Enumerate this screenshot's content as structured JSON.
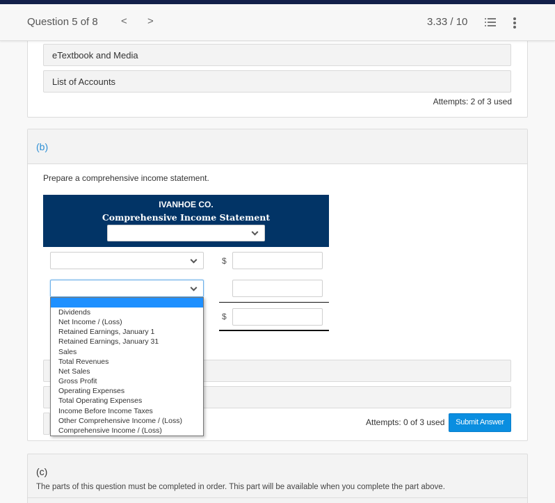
{
  "header": {
    "question_label": "Question 5 of 8",
    "prev_icon": "chevron-left-icon",
    "next_icon": "chevron-right-icon",
    "prev_glyph": "<",
    "next_glyph": ">",
    "score": "3.33 / 10",
    "list_icon": "numbered-list-icon",
    "more_icon": "more-vertical-icon"
  },
  "part_a": {
    "resources": [
      {
        "label": "eTextbook and Media"
      },
      {
        "label": "List of Accounts"
      }
    ],
    "attempts": "Attempts: 2 of 3 used"
  },
  "part_b": {
    "label": "(b)",
    "instruction": "Prepare a comprehensive income statement.",
    "statement": {
      "company": "IVANHOE CO.",
      "title": "Comprehensive Income Statement",
      "date_select_value": "",
      "rows": [
        {
          "account_value": "",
          "dollar": "$",
          "amount": ""
        },
        {
          "account_value": "",
          "dollar": "",
          "amount": ""
        },
        {
          "dollar": "$",
          "amount": ""
        }
      ]
    },
    "dropdown_options": [
      "",
      "Dividends",
      "Net Income / (Loss)",
      "Retained Earnings, January 1",
      "Retained Earnings, January 31",
      "Sales",
      "Total Revenues",
      "Net Sales",
      "Gross Profit",
      "Operating Expenses",
      "Total Operating Expenses",
      "Income Before Income Taxes",
      "Other Comprehensive Income / (Loss)",
      "Comprehensive Income / (Loss)"
    ],
    "attempts": "Attempts: 0 of 3 used",
    "submit_label": "Submit Answer"
  },
  "part_c": {
    "label": "(c)",
    "message": "The parts of this question must be completed in order. This part will be available when you complete the part above."
  },
  "colors": {
    "top_strip": "#13204a",
    "statement_header": "#023466",
    "accent_blue": "#2d8fd5",
    "submit_button": "#0a8ee0",
    "dropdown_highlight": "#1e90ff"
  }
}
